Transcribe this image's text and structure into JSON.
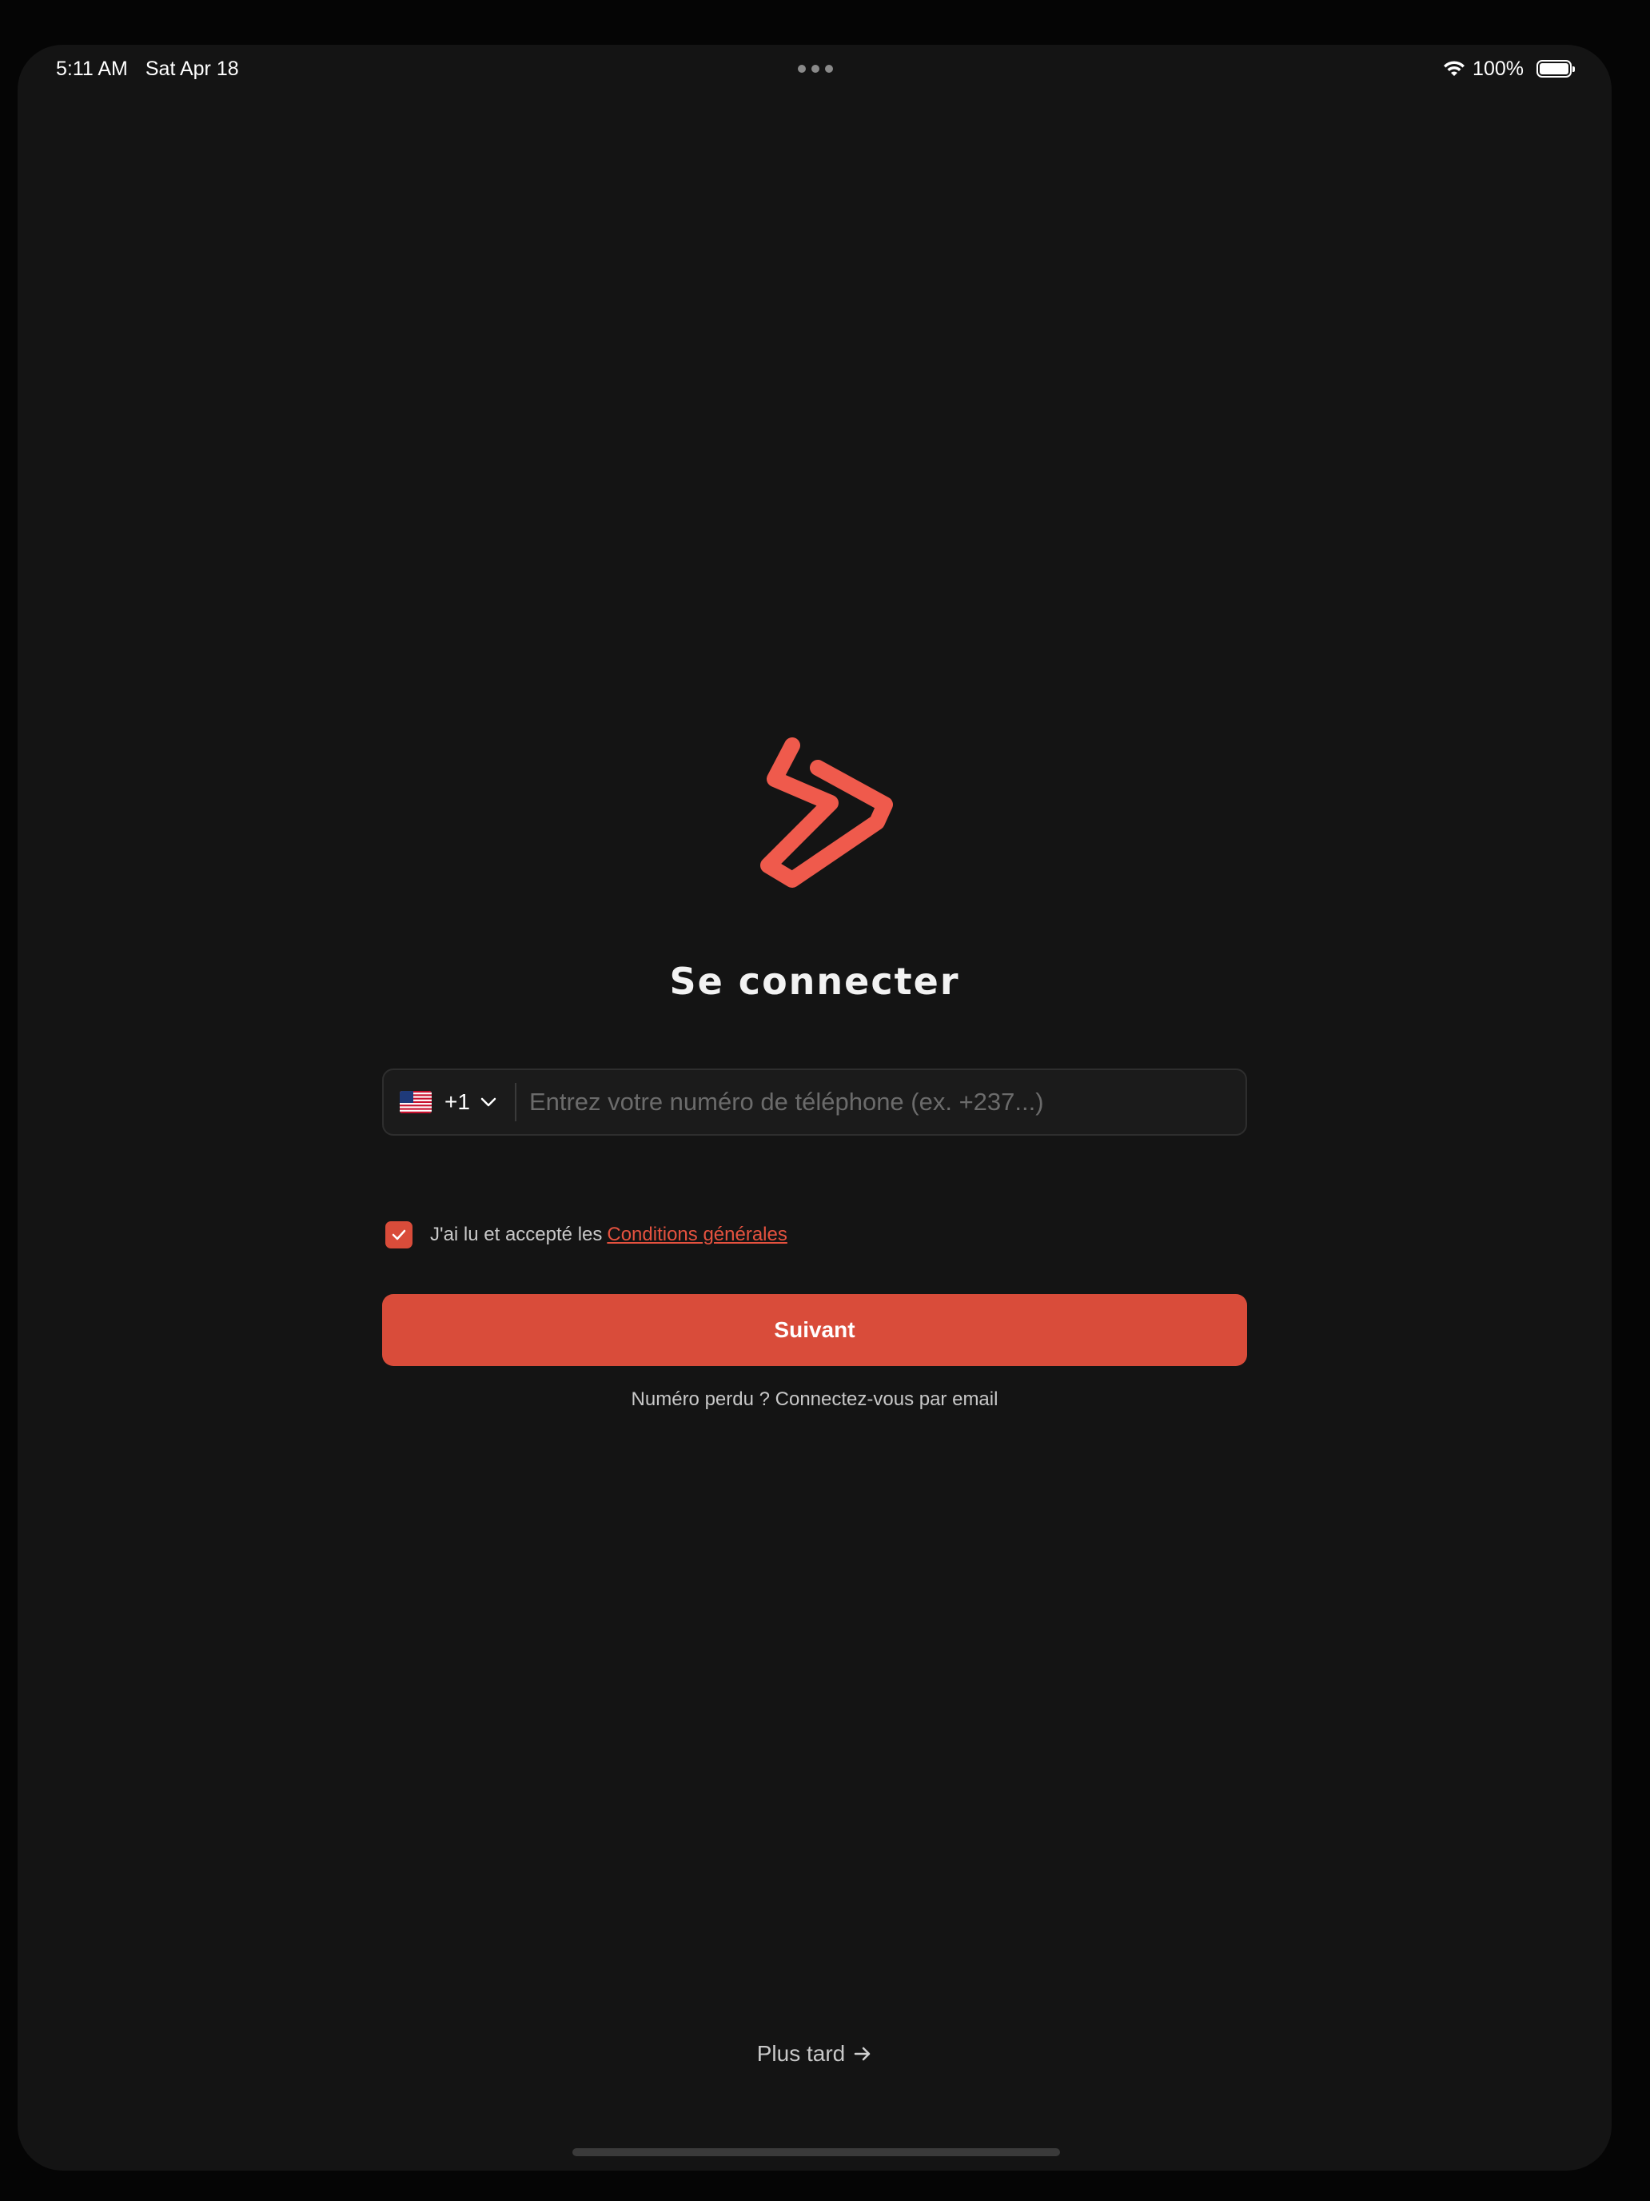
{
  "status_bar": {
    "time": "5:11 AM",
    "date": "Sat Apr 18",
    "battery": "100%",
    "icons": [
      "wifi-icon",
      "battery-icon"
    ]
  },
  "login": {
    "title": "Se connecter",
    "country_flag": "us-flag-icon",
    "dial_code": "+1",
    "phone_placeholder": "Entrez votre numéro de téléphone (ex. +237...)",
    "phone_value": "",
    "terms_checked": true,
    "terms_text": "J'ai lu et accepté les",
    "terms_link": "Conditions générales",
    "next_button": "Suivant",
    "email_link": "Numéro perdu ? Connectez-vous par email",
    "later_link": "Plus tard",
    "later_icon": "arrow-right-icon"
  },
  "colors": {
    "background": "#141414",
    "accent": "#d94c3a",
    "logo": "#ef5a4c"
  }
}
